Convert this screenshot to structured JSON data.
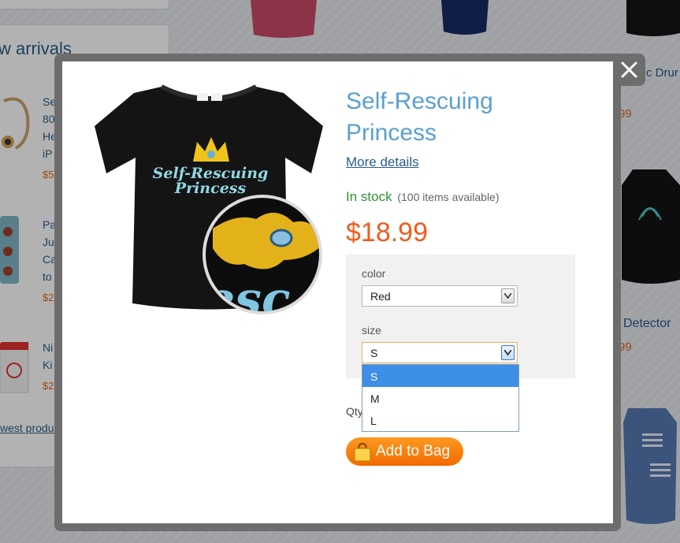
{
  "background": {
    "section_title": "w arrivals",
    "products_left": [
      {
        "lines": [
          "Se",
          "80",
          "He",
          "iP"
        ],
        "price": "$5"
      },
      {
        "lines": [
          "Pa",
          "Ju",
          "Ca",
          "to"
        ],
        "price": "$2"
      },
      {
        "lines": [
          "Ni",
          "Ki"
        ],
        "price": "$2"
      }
    ],
    "left_link": "west produ",
    "right_products": [
      {
        "name": "c Drur",
        "price": "99"
      },
      {
        "name": "Detector",
        "price": "99"
      }
    ]
  },
  "modal": {
    "title": "Self-Rescuing Princess",
    "more_details": "More details",
    "stock_status": "In stock",
    "stock_available": "(100 items available)",
    "price": "$18.99",
    "options": {
      "color_label": "color",
      "color_value": "Red",
      "size_label": "size",
      "size_value": "S",
      "size_options": [
        "S",
        "M",
        "L"
      ],
      "size_selected_index": 0
    },
    "qty_label": "Qty",
    "add_to_bag": "Add to Bag",
    "close_icon": "close-icon",
    "product_image": {
      "shirt_print_line1": "Self-Rescuing",
      "shirt_print_line2": "Princess",
      "zoom_text": "esc"
    }
  },
  "colors": {
    "title_blue": "#5b9fd0",
    "in_stock_green": "#2f9237",
    "price_orange": "#f15b1d",
    "button_orange": "#f26a00",
    "dropdown_selected": "#3d8ee6"
  }
}
